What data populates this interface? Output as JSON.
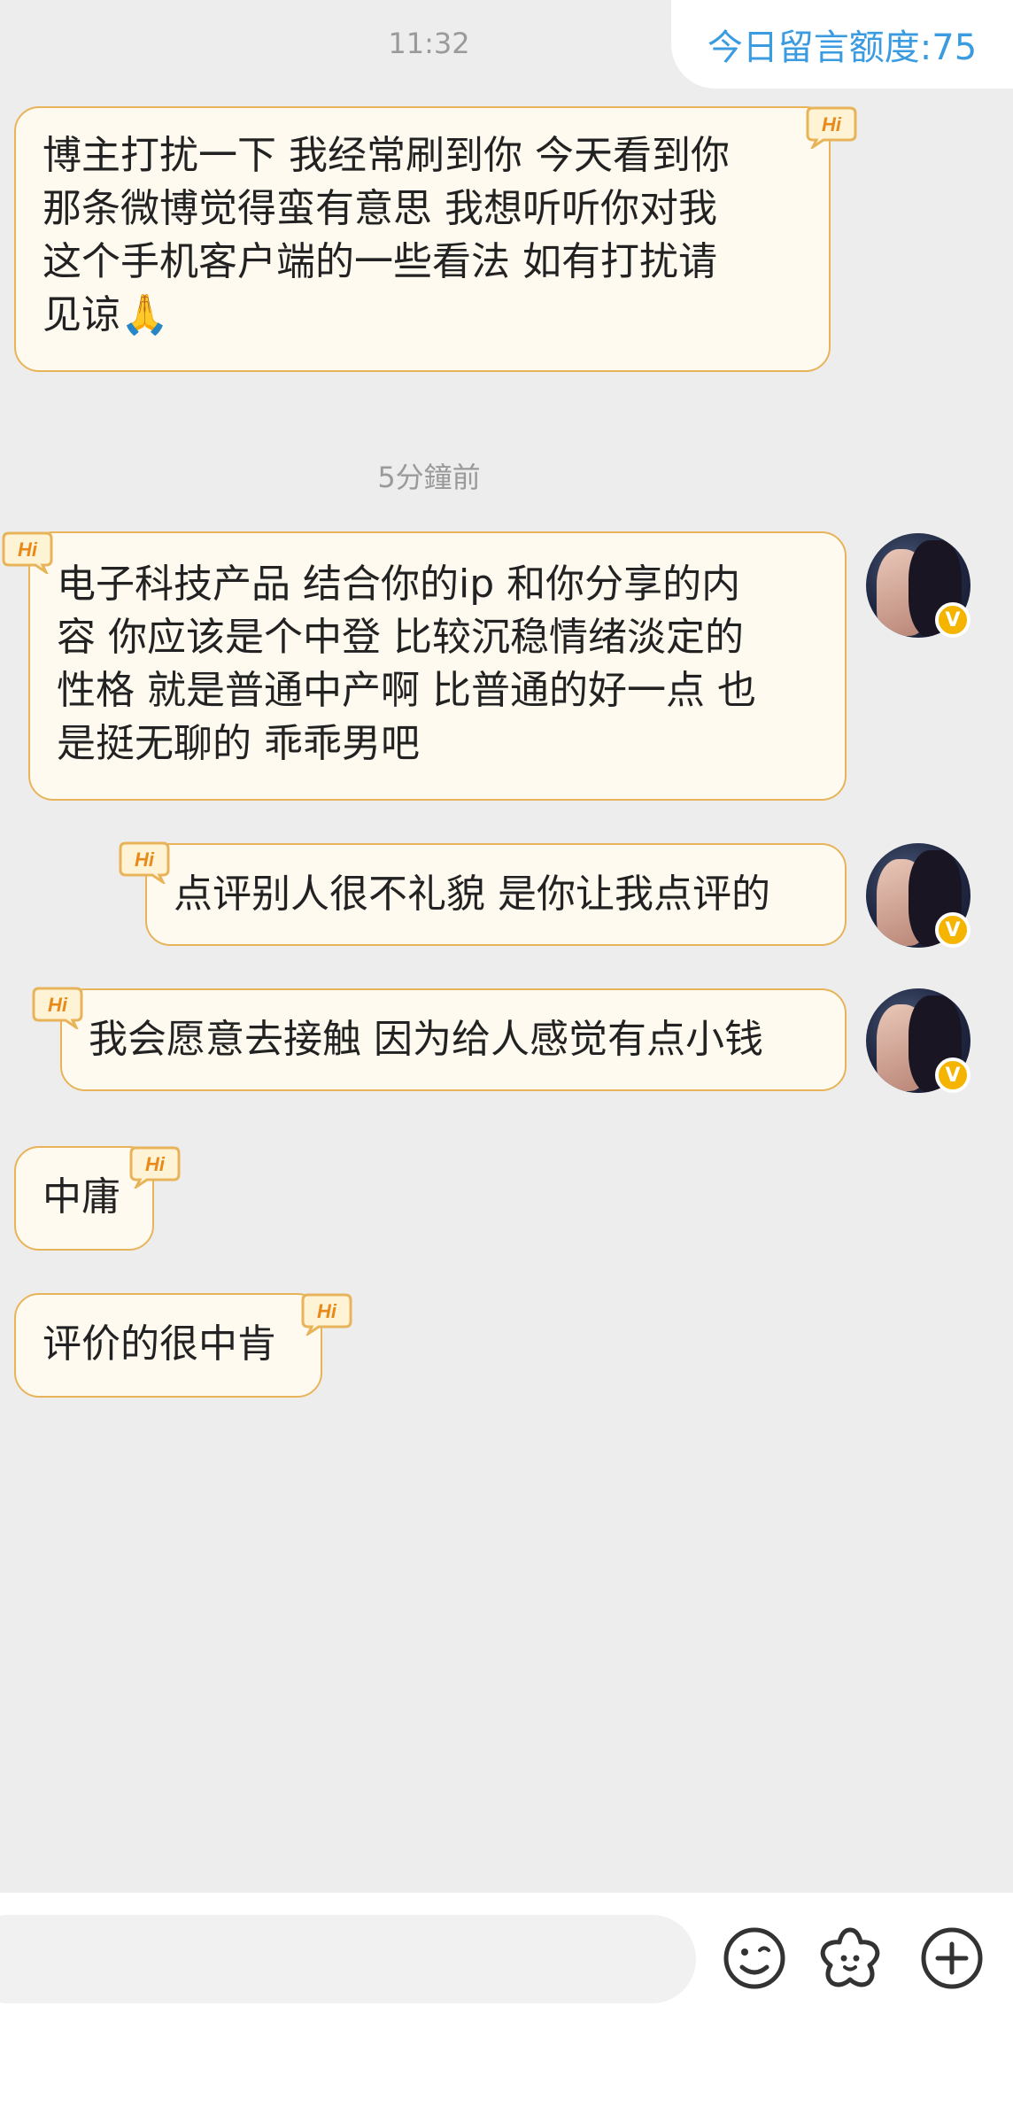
{
  "header": {
    "time": "11:32",
    "quota_label": "今日留言额度:75"
  },
  "messages": [
    {
      "side": "left",
      "hi_tag": "Hi",
      "lines": [
        "博主打扰一下 我经常刷到你 今天看到你",
        "那条微博觉得蛮有意思 我想听听你对我",
        "这个手机客户端的一些看法 如有打扰请",
        "见谅🙏"
      ]
    },
    {
      "timestamp": "5分鐘前"
    },
    {
      "side": "right",
      "hi_tag": "Hi",
      "lines": [
        "电子科技产品 结合你的ip  和你分享的内",
        "容 你应该是个中登 比较沉稳情绪淡定的",
        "性格 就是普通中产啊 比普通的好一点 也",
        "是挺无聊的 乖乖男吧"
      ],
      "verified": "V"
    },
    {
      "side": "right",
      "hi_tag": "Hi",
      "lines": [
        "点评别人很不礼貌 是你让我点评的"
      ],
      "verified": "V"
    },
    {
      "side": "right",
      "hi_tag": "Hi",
      "lines": [
        "我会愿意去接触 因为给人感觉有点小钱"
      ],
      "verified": "V"
    },
    {
      "side": "left",
      "hi_tag": "Hi",
      "lines": [
        "中庸"
      ]
    },
    {
      "side": "left",
      "hi_tag": "Hi",
      "lines": [
        "评价的很中肯"
      ]
    }
  ],
  "input_bar": {
    "icons": [
      "emoji-icon",
      "sticker-flower-icon",
      "plus-icon"
    ]
  },
  "colors": {
    "background": "#ededed",
    "bubble_fill": "#fffaf0",
    "bubble_border": "#e8b45a",
    "quota_text": "#3b9be0",
    "verified_badge": "#f4b400"
  }
}
